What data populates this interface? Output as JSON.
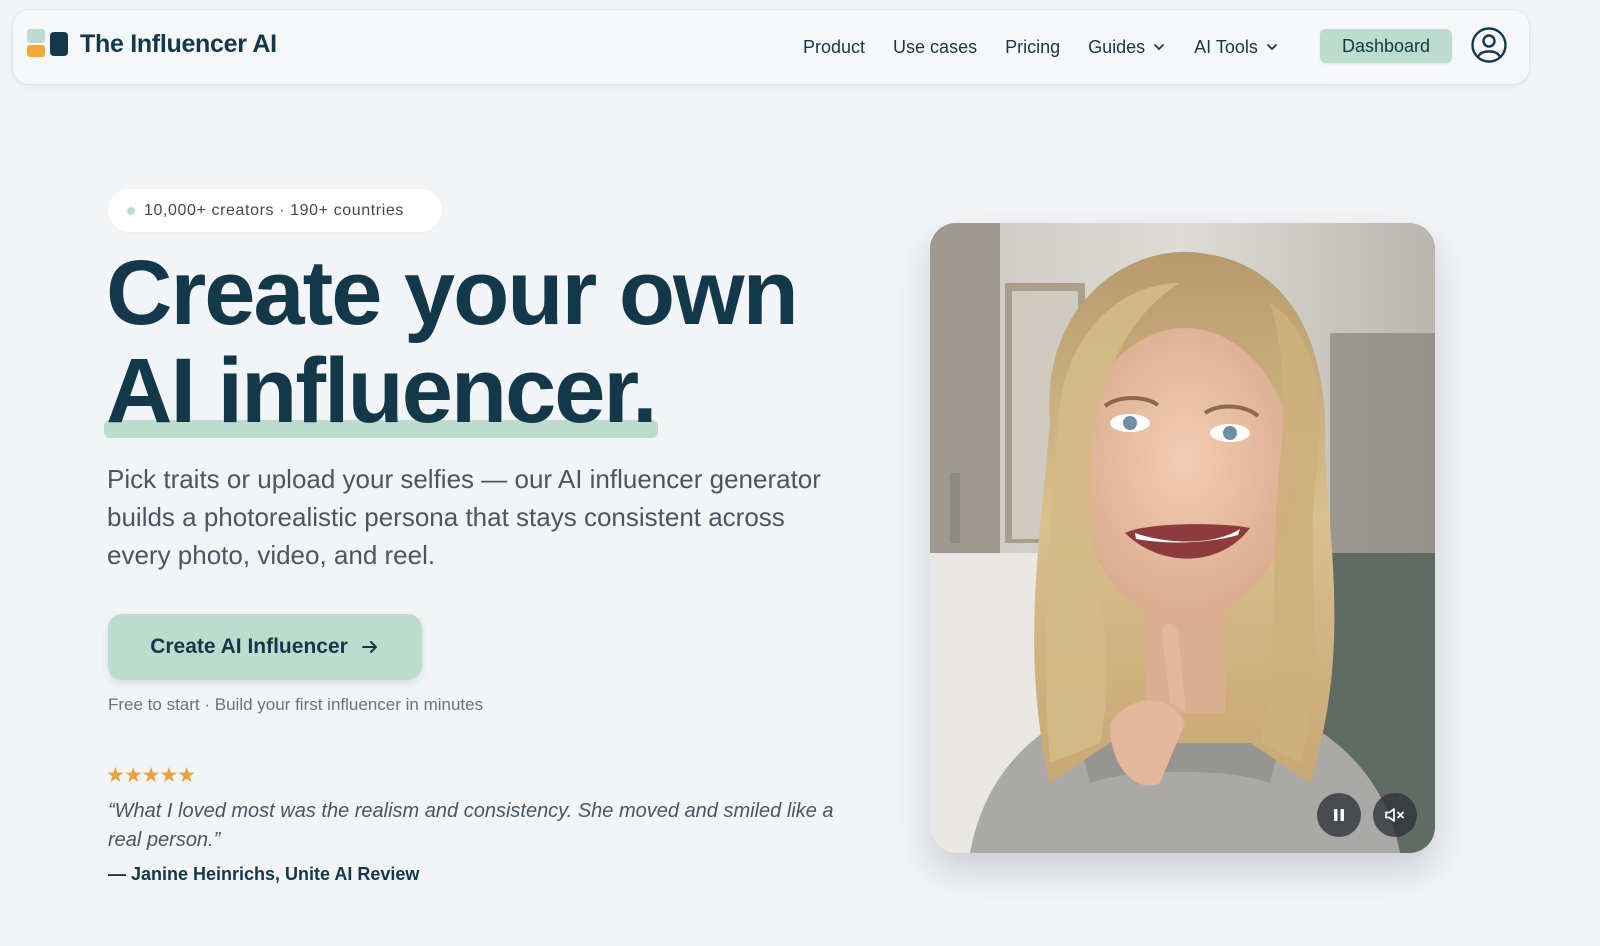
{
  "brand": {
    "name": "The Influencer AI",
    "logo": "logo-blocks"
  },
  "nav": {
    "links": [
      {
        "label": "Product",
        "dropdown": false
      },
      {
        "label": "Use cases",
        "dropdown": false
      },
      {
        "label": "Pricing",
        "dropdown": false
      },
      {
        "label": "Guides",
        "dropdown": true
      },
      {
        "label": "AI Tools",
        "dropdown": true
      }
    ],
    "dashboard_label": "Dashboard",
    "account_icon": "user-circle-icon"
  },
  "hero": {
    "badge": "10,000+ creators · 190+ countries",
    "headline_line1": "Create your own",
    "headline_line2": "AI influencer.",
    "subtitle": "Pick traits or upload your selfies — our AI influencer generator builds a photorealistic persona that stays consistent across every photo, video, and reel.",
    "cta_label": "Create AI Influencer",
    "fine_print": "Free to start · Build your first influencer in minutes",
    "rating": {
      "stars": 5,
      "display": "★★★★★"
    },
    "testimonial_quote": "“What I loved most was the realism and consistency. She moved and smiled like a real person.”",
    "testimonial_author": "— Janine Heinrichs, Unite AI Review"
  },
  "video": {
    "state": "playing",
    "muted": true,
    "controls": [
      "pause-icon",
      "mute-icon"
    ]
  },
  "colors": {
    "background": "#f2f4f6",
    "primary_text": "#12384a",
    "accent_mint": "#bcdccd",
    "accent_orange": "#f0a93a",
    "star": "#e8a23e"
  }
}
